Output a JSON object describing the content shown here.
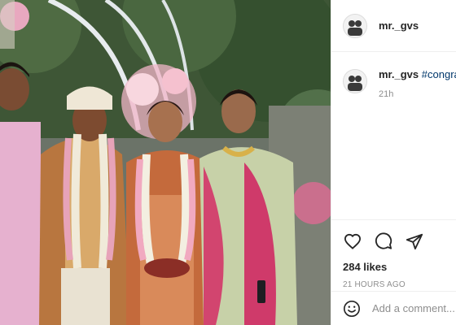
{
  "post": {
    "username": "mr._gvs",
    "image_alt": "Wedding group photo"
  },
  "caption": {
    "username": "mr._gvs",
    "text": "#congrat",
    "time": "21h"
  },
  "engagement": {
    "likes": "284 likes",
    "posted_ago": "21 HOURS AGO"
  },
  "comment_box": {
    "placeholder": "Add a comment..."
  },
  "icons": {
    "like": "heart-icon",
    "comment": "comment-bubble-icon",
    "share": "share-paper-plane-icon",
    "emoji": "emoji-smile-icon"
  },
  "colors": {
    "hashtag": "#00376b",
    "muted_text": "#8e8e8e",
    "border": "#efefef"
  }
}
